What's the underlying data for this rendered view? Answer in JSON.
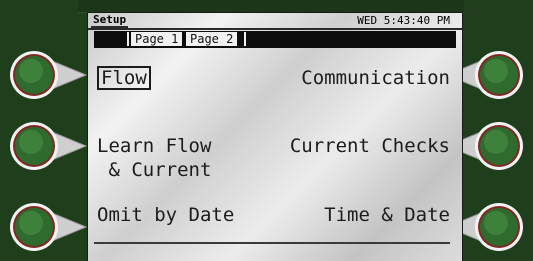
{
  "status": {
    "crumb": "Setup",
    "clock": "WED 5:43:40 PM"
  },
  "pages": {
    "tab1": "Page 1",
    "tab2": "Page 2"
  },
  "menu": {
    "left": {
      "item1": "Flow",
      "item2": "Learn Flow\n & Current",
      "item3": "Omit by Date"
    },
    "right": {
      "item1": "Communication",
      "item2": "Current Checks",
      "item3": "Time & Date"
    }
  },
  "colors": {
    "bezel": "#1f3f1c",
    "button_fill": "#3a7a3a",
    "button_ring": "#8a2a22",
    "screen": "#e6e6e6"
  }
}
